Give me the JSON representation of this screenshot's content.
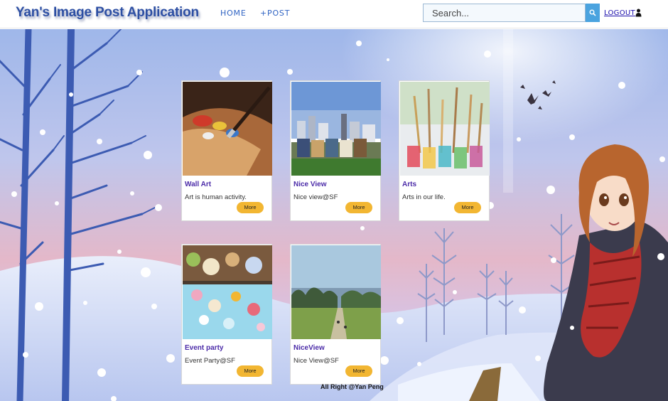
{
  "header": {
    "brand": "Yan's Image Post Application",
    "nav": {
      "home": "HOME",
      "post": "+POST"
    },
    "search": {
      "placeholder": "Search..."
    },
    "logout": "LOGOUT"
  },
  "posts": [
    {
      "title": "Wall Art",
      "description": "Art is human activity.",
      "more": "More"
    },
    {
      "title": "Nice View",
      "description": "Nice view@SF",
      "more": "More"
    },
    {
      "title": "Arts",
      "description": "Arts in our life.",
      "more": "More"
    },
    {
      "title": "Event party",
      "description": "Event Party@SF",
      "more": "More"
    },
    {
      "title": "NiceView",
      "description": "Nice View@SF",
      "more": "More"
    }
  ],
  "footer": {
    "credit": "All Right @Yan Peng"
  },
  "colors": {
    "brand": "#2d4fa3",
    "nav": "#2f63c3",
    "search_button": "#4aa3df",
    "card_title": "#4b2ba8",
    "more_button": "#f2b632"
  },
  "icons": {
    "search": "magnifier-icon",
    "user": "user-icon"
  }
}
